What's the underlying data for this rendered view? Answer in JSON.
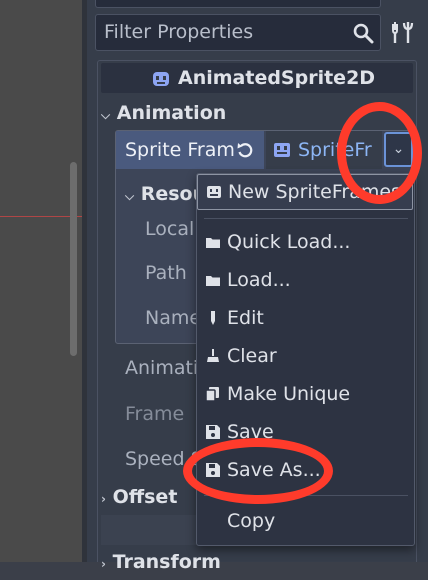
{
  "colors": {
    "panel_bg": "#363d4a",
    "selected_label_bg": "#4a5a7e",
    "resource_link": "#8db6f5",
    "annotation_red": "#ff3b2b"
  },
  "inspector": {
    "filter_placeholder": "Filter Properties",
    "search_icon": "search-icon",
    "tools_icon": "filter-tools-icon",
    "node_title": "AnimatedSprite2D",
    "node_icon": "animated-sprite-2d-icon"
  },
  "sections": {
    "animation": "Animation",
    "resource": "Resou",
    "offset": "Offset",
    "transform": "Transform"
  },
  "sprite_frames": {
    "label": "Sprite Fram",
    "value": "SpriteFr"
  },
  "resource_props": {
    "local": "Local",
    "path": "Path",
    "name": "Name"
  },
  "animation_props": {
    "animation": "Animatio",
    "frame": "Frame",
    "speed": "Speed S"
  },
  "menu": {
    "new": "New SpriteFrames",
    "quick_load": "Quick Load...",
    "load": "Load...",
    "edit": "Edit",
    "clear": "Clear",
    "make_unique": "Make Unique",
    "save": "Save",
    "save_as": "Save As...",
    "copy": "Copy"
  }
}
